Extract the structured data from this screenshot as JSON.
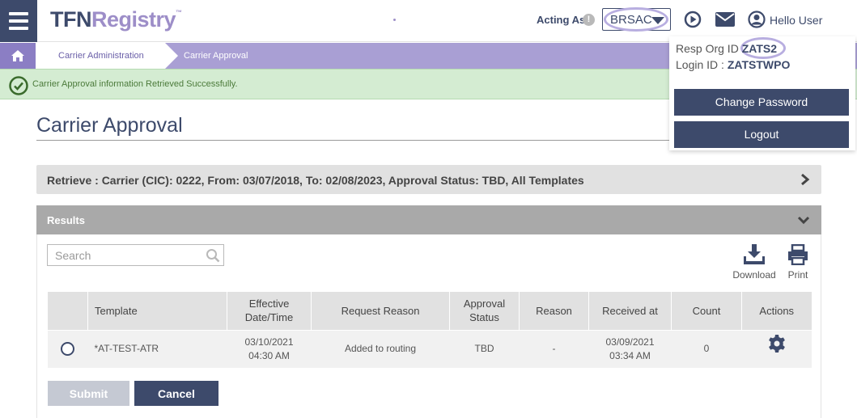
{
  "header": {
    "logo_tfn": "TFN",
    "logo_registry": "Registry",
    "logo_tm": "™",
    "acting_as_label": "Acting As",
    "info_glyph": "!",
    "acting_as_value": "BRSAC",
    "user_greeting": "Hello User",
    "icons": [
      "menu-icon",
      "info-icon",
      "chevron-down-icon",
      "play-circle-icon",
      "mail-icon",
      "user-circle-icon"
    ]
  },
  "breadcrumb": {
    "items": [
      "Carrier Administration",
      "Carrier Approval"
    ]
  },
  "alert": {
    "message": "Carrier Approval information Retrieved Successfully."
  },
  "page": {
    "title": "Carrier Approval"
  },
  "retrieve": {
    "summary": "Retrieve : Carrier (CIC): 0222, From: 03/07/2018, To: 02/08/2023, Approval Status: TBD, All Templates"
  },
  "results": {
    "title": "Results",
    "search_placeholder": "Search",
    "download_label": "Download",
    "print_label": "Print",
    "columns": {
      "template": "Template",
      "effective": "Effective Date/Time",
      "request_reason": "Request Reason",
      "approval_status": "Approval Status",
      "reason": "Reason",
      "received_at": "Received at",
      "count": "Count",
      "actions": "Actions"
    },
    "rows": [
      {
        "template": "*AT-TEST-ATR",
        "effective_date": "03/10/2021",
        "effective_time": "04:30 AM",
        "request_reason": "Added to routing",
        "approval_status": "TBD",
        "reason": "-",
        "received_date": "03/09/2021",
        "received_time": "03:34 AM",
        "count": "0"
      }
    ]
  },
  "buttons": {
    "submit": "Submit",
    "cancel": "Cancel"
  },
  "user_menu": {
    "resp_org_label": "Resp Org ID",
    "resp_org_value": "ZATS2",
    "login_label": "Login ID :",
    "login_value": "ZATSTWPO",
    "change_password": "Change Password",
    "logout": "Logout"
  },
  "colors": {
    "navy": "#3d4a6b",
    "lavender": "#a99fd4",
    "success_bg": "#d4ecd2",
    "panel_gray": "#a9a9a9"
  }
}
